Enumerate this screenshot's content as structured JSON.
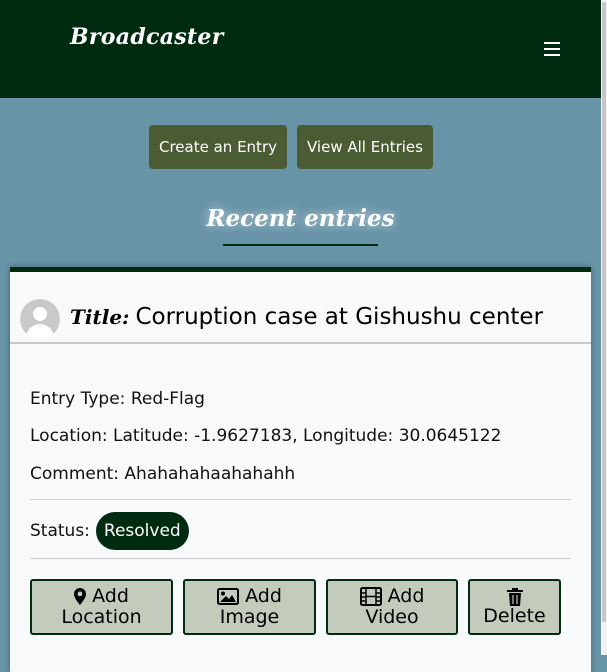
{
  "header": {
    "brand": "Broadcaster",
    "menu_icon": "hamburger-icon"
  },
  "actions": {
    "create_label": "Create an Entry",
    "view_label": "View All Entries"
  },
  "section": {
    "title": "Recent entries"
  },
  "entry": {
    "avatar_icon": "user-avatar-icon",
    "title_prefix": "Title:",
    "title": "Corruption case at Gishushu center",
    "entry_type": "Entry Type: Red-Flag",
    "location": "Location: Latitude: -1.9627183, Longitude: 30.0645122",
    "comment": "Comment: Ahahahahaahahahh",
    "status_label": "Status:",
    "status": "Resolved",
    "buttons": {
      "add_location": {
        "line1": "Add",
        "line2": "Location",
        "icon": "map-marker-icon"
      },
      "add_image": {
        "line1": "Add",
        "line2": "Image",
        "icon": "image-icon"
      },
      "add_video": {
        "line1": "Add",
        "line2": "Video",
        "icon": "film-icon"
      },
      "delete": {
        "line1": "",
        "line2": "Delete",
        "icon": "trash-icon"
      }
    }
  },
  "colors": {
    "header_bg": "#012b10",
    "page_bg": "#6894a8",
    "primary_button": "#4b5c34",
    "card_button": "#c3cbbd",
    "status_badge": "#012b10"
  }
}
